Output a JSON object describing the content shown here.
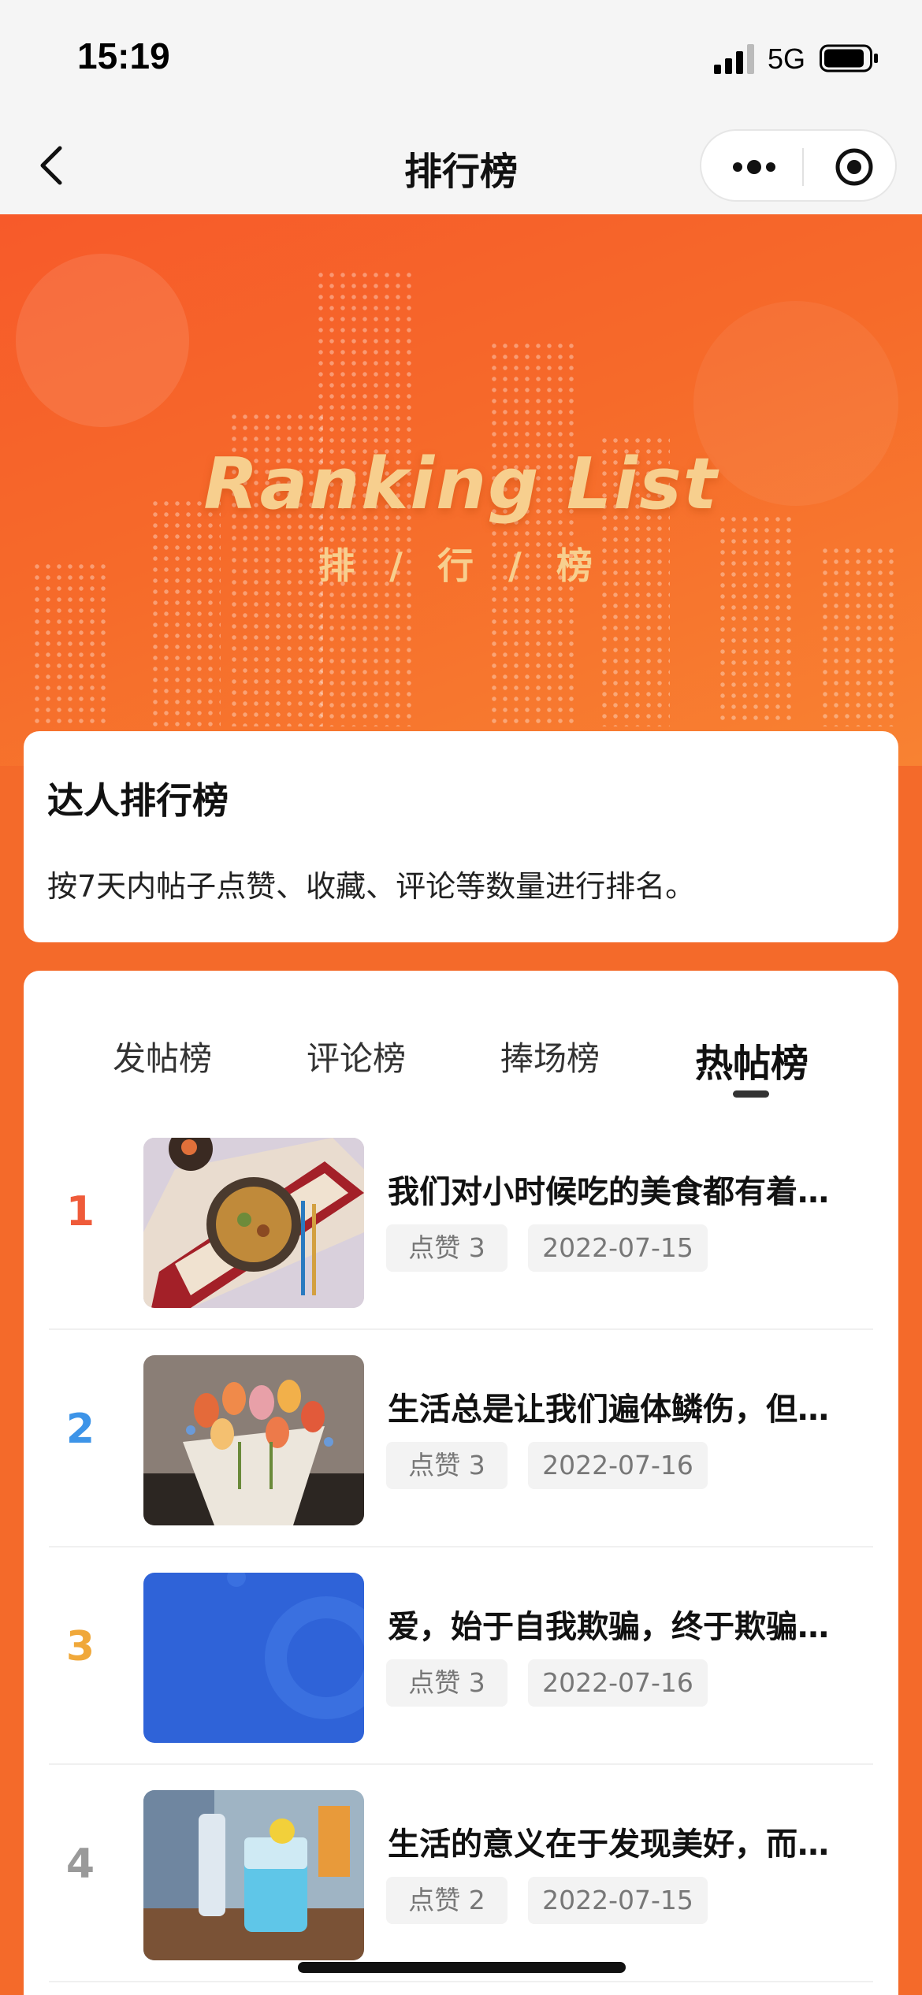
{
  "status_bar": {
    "time": "15:19",
    "network": "5G"
  },
  "nav": {
    "title": "排行榜"
  },
  "banner": {
    "title": "Ranking List",
    "subtitle": "排 / 行 / 榜"
  },
  "info_card": {
    "title": "达人排行榜",
    "description": "按7天内帖子点赞、收藏、评论等数量进行排名。"
  },
  "tabs": [
    {
      "label": "发帖榜",
      "active": false
    },
    {
      "label": "评论榜",
      "active": false
    },
    {
      "label": "捧场榜",
      "active": false
    },
    {
      "label": "热帖榜",
      "active": true
    }
  ],
  "posts": [
    {
      "rank": "1",
      "rank_color": "#ef5b3a",
      "title": "我们对小时候吃的美食都有着…",
      "likes": "点赞 3",
      "date": "2022-07-15"
    },
    {
      "rank": "2",
      "rank_color": "#3d94e8",
      "title": "生活总是让我们遍体鳞伤，但…",
      "likes": "点赞 3",
      "date": "2022-07-16"
    },
    {
      "rank": "3",
      "rank_color": "#f0a83a",
      "title": "爱，始于自我欺骗，终于欺骗…",
      "likes": "点赞 3",
      "date": "2022-07-16"
    },
    {
      "rank": "4",
      "rank_color": "#9a9a9a",
      "title": "生活的意义在于发现美好，而…",
      "likes": "点赞 2",
      "date": "2022-07-15"
    }
  ]
}
